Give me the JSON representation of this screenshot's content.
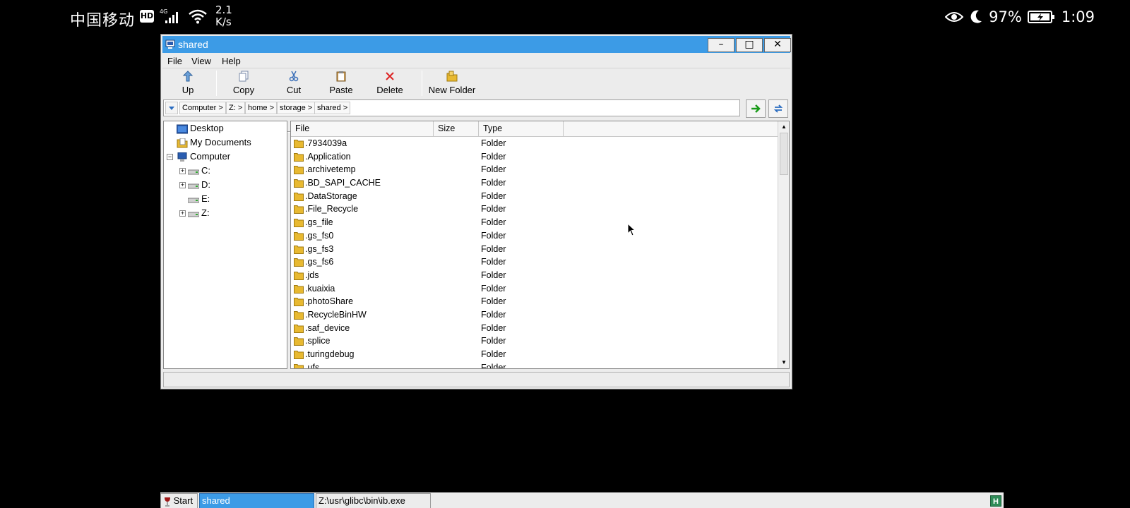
{
  "status_bar": {
    "carrier": "中国移动",
    "hd_badge": "HD",
    "network": "4G",
    "speed_value": "2.1",
    "speed_unit": "K/s",
    "battery": "97%",
    "time": "1:09"
  },
  "window": {
    "title": "shared",
    "controls": {
      "minimize": "–",
      "maximize": "□",
      "close": "✕"
    }
  },
  "menu": [
    "File",
    "View",
    "Help"
  ],
  "toolbar": {
    "up": "Up",
    "copy": "Copy",
    "cut": "Cut",
    "paste": "Paste",
    "delete": "Delete",
    "new_folder": "New Folder"
  },
  "address": {
    "crumbs": [
      "Computer >",
      "Z: >",
      "home >",
      "storage >",
      "shared >"
    ]
  },
  "tree": {
    "desktop": "Desktop",
    "my_documents": "My Documents",
    "computer": "Computer",
    "drives": [
      "C:",
      "D:",
      "E:",
      "Z:"
    ]
  },
  "list": {
    "columns": [
      "File",
      "Size",
      "Type"
    ],
    "rows": [
      {
        "name": ".7934039a",
        "type": "Folder"
      },
      {
        "name": ".Application",
        "type": "Folder"
      },
      {
        "name": ".archivetemp",
        "type": "Folder"
      },
      {
        "name": ".BD_SAPI_CACHE",
        "type": "Folder"
      },
      {
        "name": ".DataStorage",
        "type": "Folder"
      },
      {
        "name": ".File_Recycle",
        "type": "Folder"
      },
      {
        "name": ".gs_file",
        "type": "Folder"
      },
      {
        "name": ".gs_fs0",
        "type": "Folder"
      },
      {
        "name": ".gs_fs3",
        "type": "Folder"
      },
      {
        "name": ".gs_fs6",
        "type": "Folder"
      },
      {
        "name": ".jds",
        "type": "Folder"
      },
      {
        "name": ".kuaixia",
        "type": "Folder"
      },
      {
        "name": ".photoShare",
        "type": "Folder"
      },
      {
        "name": ".RecycleBinHW",
        "type": "Folder"
      },
      {
        "name": ".saf_device",
        "type": "Folder"
      },
      {
        "name": ".splice",
        "type": "Folder"
      },
      {
        "name": ".turingdebug",
        "type": "Folder"
      },
      {
        "name": ".ufs",
        "type": "Folder"
      }
    ]
  },
  "taskbar": {
    "start": "Start",
    "task_active": "shared",
    "task_other": "Z:\\usr\\glibc\\bin\\ib.exe",
    "tray_letter": "H"
  },
  "colors": {
    "titlebar": "#3c9be6",
    "folder": "#e8b931",
    "delete_red": "#d22",
    "go_green": "#1a9b1a"
  }
}
